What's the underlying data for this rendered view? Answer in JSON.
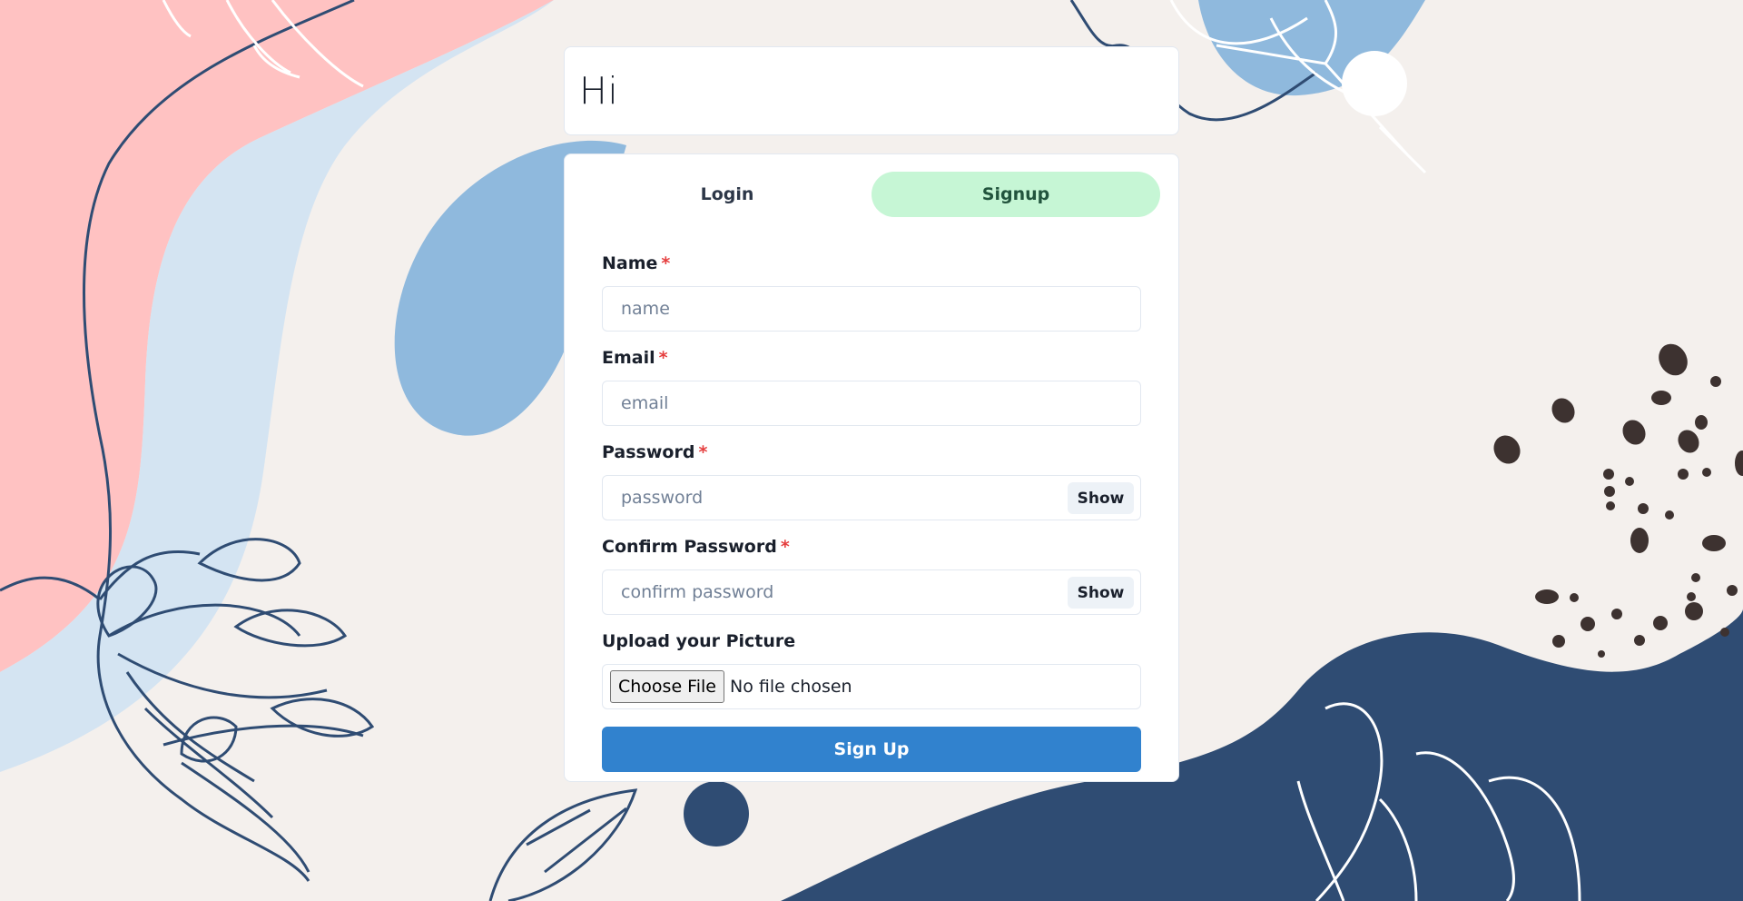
{
  "page_title": "Hi",
  "tabs": [
    {
      "label": "Login",
      "active": false
    },
    {
      "label": "Signup",
      "active": true
    }
  ],
  "form": {
    "name": {
      "label": "Name",
      "required_mark": "*",
      "placeholder": "name"
    },
    "email": {
      "label": "Email",
      "required_mark": "*",
      "placeholder": "email"
    },
    "password": {
      "label": "Password",
      "required_mark": "*",
      "placeholder": "password",
      "toggle_label": "Show"
    },
    "confirm_password": {
      "label": "Confirm Password",
      "required_mark": "*",
      "placeholder": "confirm password",
      "toggle_label": "Show"
    },
    "picture": {
      "label": "Upload your Picture",
      "button_label": "Choose File",
      "status": "No file chosen"
    },
    "submit_label": "Sign Up"
  },
  "colors": {
    "background": "#f4f0ed",
    "pink_blob": "#ffc2c2",
    "light_blue_blob": "#d4e4f2",
    "mid_blue_blob": "#8fb9dd",
    "navy_blob": "#2f4c73",
    "active_tab": "#c6f6d5",
    "primary_button": "#3182ce",
    "required": "#e53e3e"
  }
}
